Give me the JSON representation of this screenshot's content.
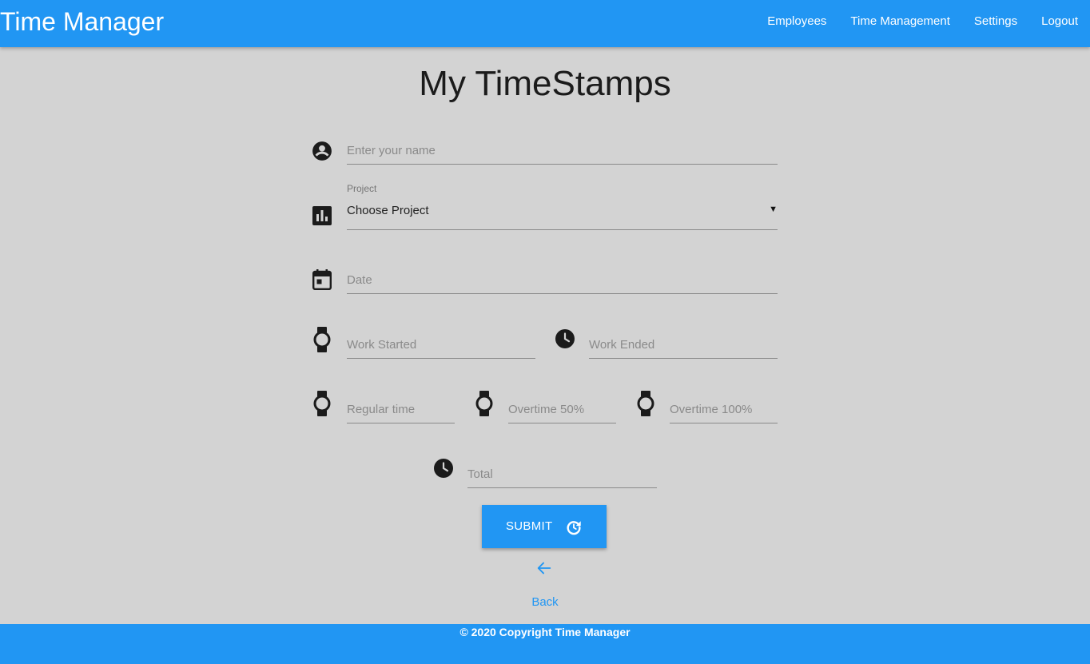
{
  "header": {
    "brand": "Time Manager",
    "nav": [
      "Employees",
      "Time Management",
      "Settings",
      "Logout"
    ]
  },
  "page": {
    "title": "My TimeStamps"
  },
  "form": {
    "name": {
      "placeholder": "Enter your name",
      "icon": "account-circle-icon"
    },
    "project": {
      "label": "Project",
      "value": "Choose Project",
      "arrow": "▼",
      "icon": "bar-chart-icon"
    },
    "date": {
      "placeholder": "Date",
      "icon": "calendar-icon"
    },
    "work_started": {
      "placeholder": "Work Started",
      "icon": "watch-icon"
    },
    "work_ended": {
      "placeholder": "Work Ended",
      "icon": "clock-icon"
    },
    "regular_time": {
      "placeholder": "Regular time",
      "icon": "watch-icon"
    },
    "overtime_50": {
      "placeholder": "Overtime 50%",
      "icon": "watch-icon"
    },
    "overtime_100": {
      "placeholder": "Overtime 100%",
      "icon": "watch-icon"
    },
    "total": {
      "placeholder": "Total",
      "icon": "clock-icon"
    },
    "submit_label": "SUBMIT",
    "submit_icon": "refresh-icon",
    "back_icon": "arrow-left-icon",
    "back_label": "Back"
  },
  "footer": {
    "text": "© 2020 Copyright Time Manager"
  },
  "colors": {
    "primary": "#2196f3",
    "background": "#d3d3d3",
    "icon": "#1b1b1b"
  }
}
